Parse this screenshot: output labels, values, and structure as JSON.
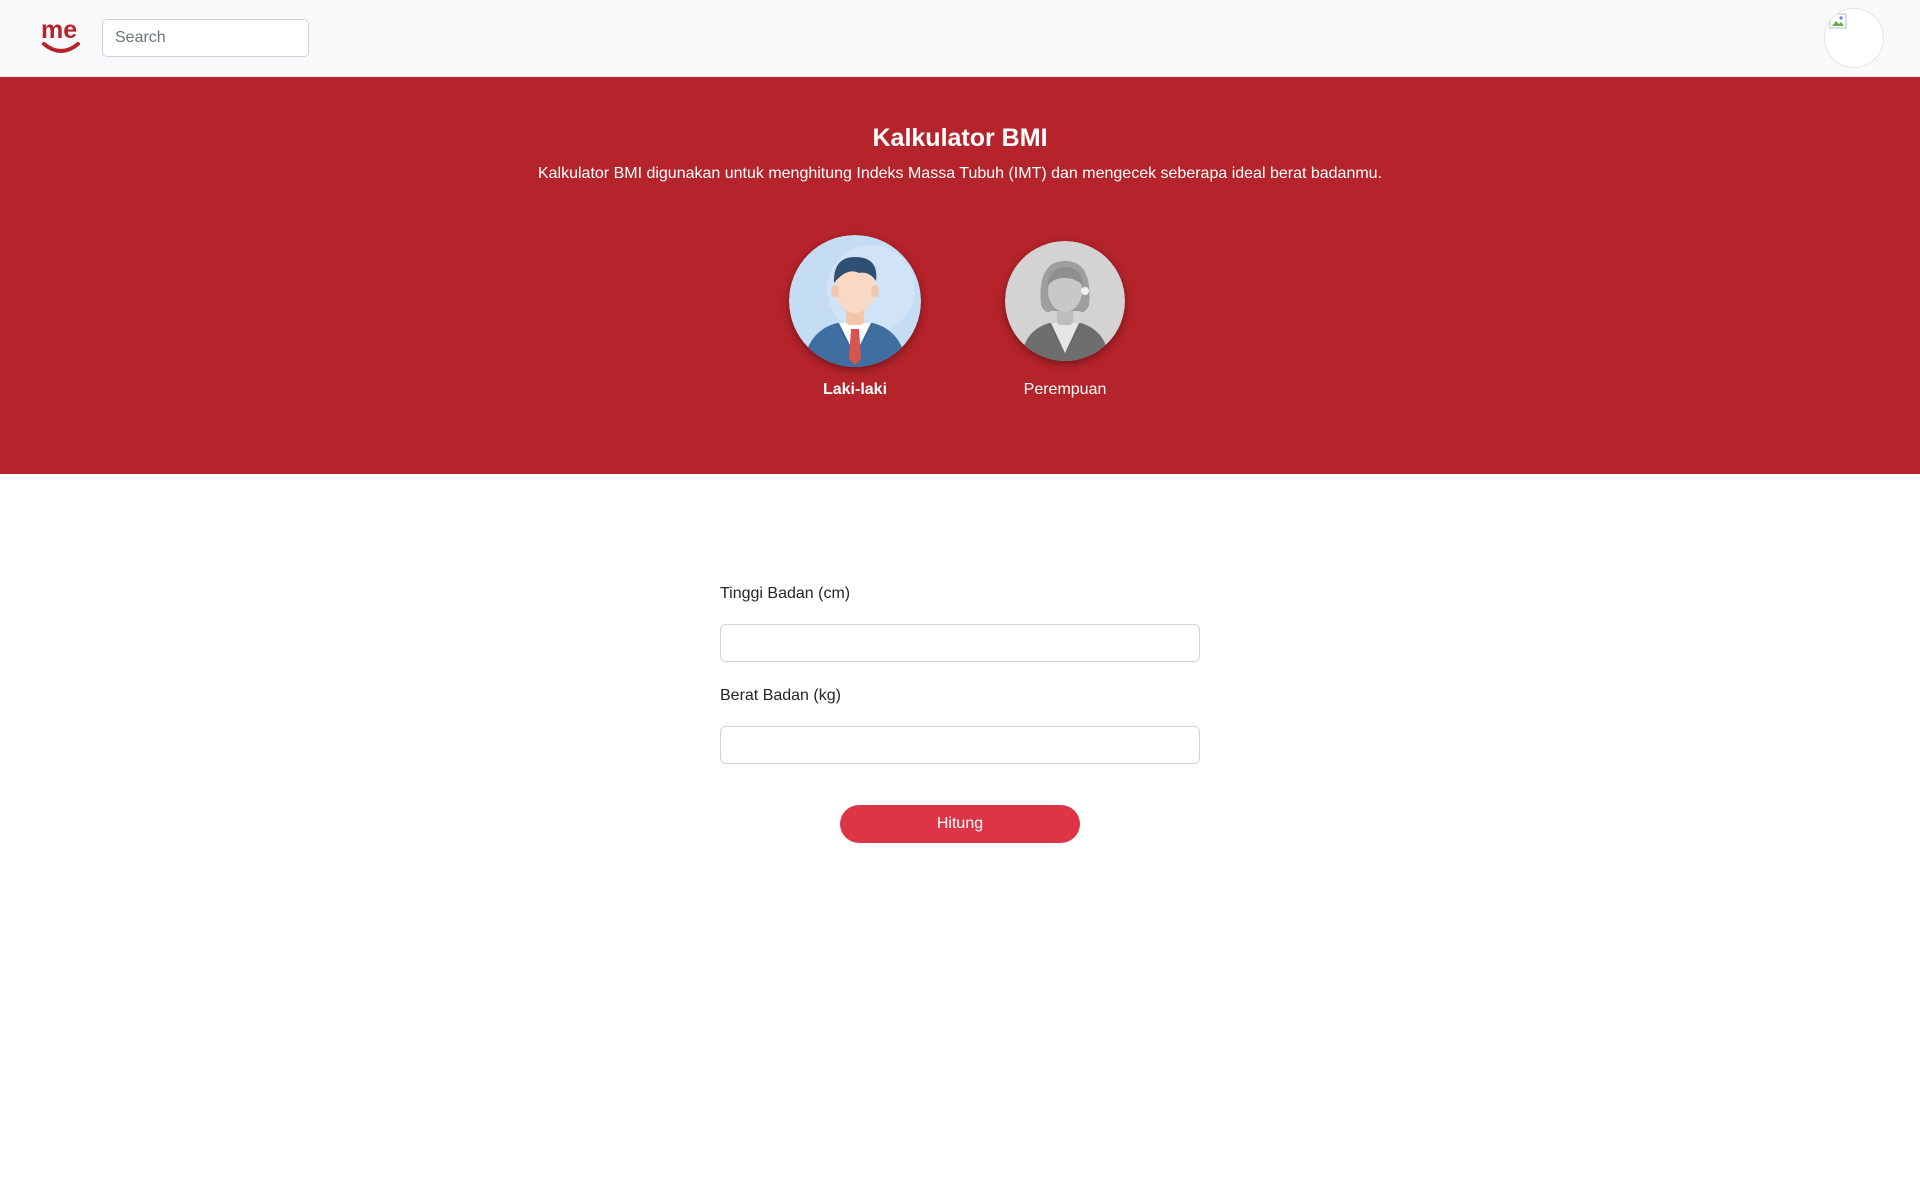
{
  "navbar": {
    "brand_text": "me",
    "brand_color": "#b5232b",
    "search": {
      "placeholder": "Search",
      "value": ""
    },
    "avatar_icon": "broken-image-icon"
  },
  "hero": {
    "background": "#b5232b",
    "title": "Kalkulator BMI",
    "subtitle": "Kalkulator BMI digunakan untuk menghitung Indeks Massa Tubuh (IMT) dan mengecek seberapa ideal berat badanmu.",
    "genders": [
      {
        "label": "Laki-laki",
        "selected": true,
        "icon": "male-avatar-icon"
      },
      {
        "label": "Perempuan",
        "selected": false,
        "icon": "female-avatar-icon"
      }
    ]
  },
  "form": {
    "height_label": "Tinggi Badan (cm)",
    "height_value": "",
    "weight_label": "Berat Badan (kg)",
    "weight_value": "",
    "submit_label": "Hitung",
    "submit_color": "#dc3545"
  }
}
